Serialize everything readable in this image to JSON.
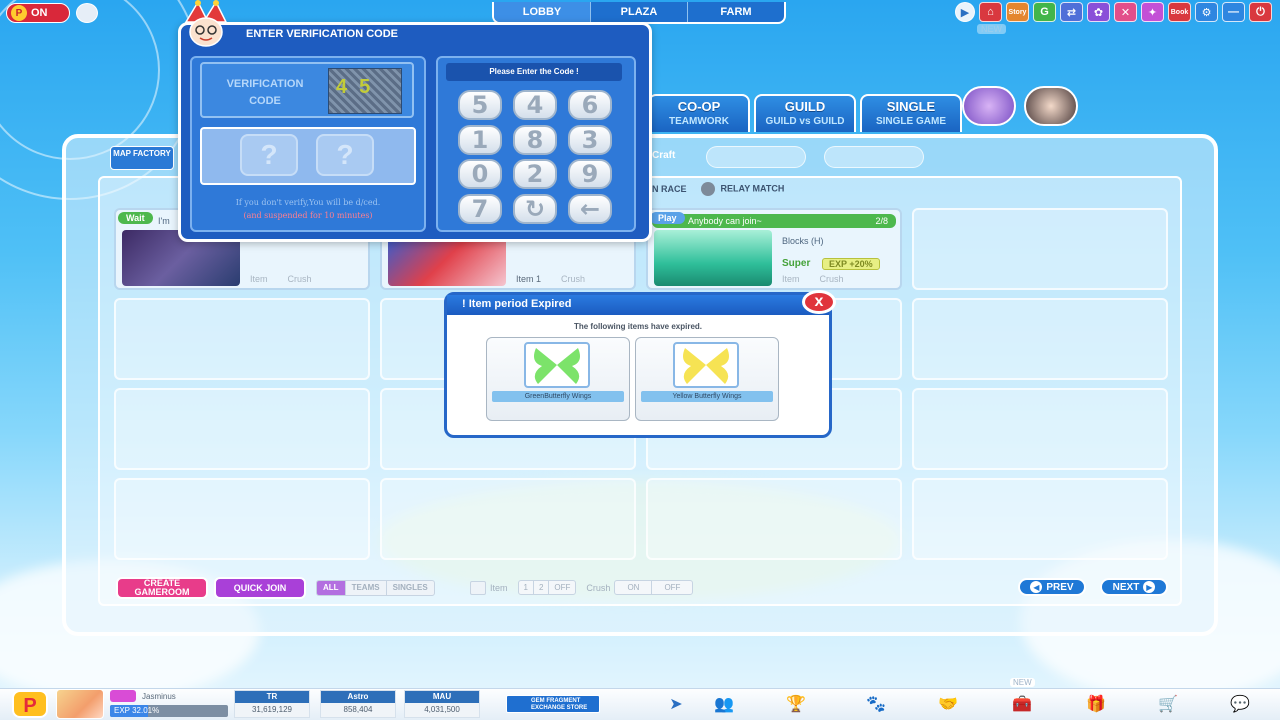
{
  "top_bar": {
    "on_label": "ON",
    "main_tabs": [
      "LOBBY",
      "PLAZA",
      "FARM"
    ],
    "new_tag": "NEW"
  },
  "mode_tabs": [
    {
      "title": "CO-OP",
      "subtitle": "TEAMWORK"
    },
    {
      "title": "GUILD",
      "subtitle": "GUILD vs GUILD"
    },
    {
      "title": "SINGLE",
      "subtitle": "SINGLE GAME"
    }
  ],
  "lobby": {
    "map_factory_label": "MAP FACTORY",
    "craft_label": "Craft",
    "filters": [
      "N RACE",
      "RELAY MATCH"
    ]
  },
  "rooms": [
    {
      "badge": "Wait",
      "title": "I'm",
      "items": [
        "Item",
        "Crush"
      ]
    },
    {
      "badge": "",
      "title": "",
      "items": [
        "Item 1",
        "Crush"
      ]
    },
    {
      "badge": "Play",
      "title": "Anybody can join~",
      "count": "2/8",
      "map": "Blocks (H)",
      "super": "Super",
      "exp": "EXP +20%",
      "items": [
        "Item",
        "Crush"
      ]
    }
  ],
  "bottom_controls": {
    "create_gameroom": "CREATE GAMEROOM",
    "quick_join": "QUICK JOIN",
    "mode_filter": [
      "ALL",
      "TEAMS",
      "SINGLES"
    ],
    "item_label": "Item",
    "item_opts": [
      "1",
      "2",
      "OFF"
    ],
    "crush_label": "Crush",
    "crush_opts": [
      "ON",
      "OFF"
    ],
    "prev": "PREV",
    "next": "NEXT"
  },
  "status_bar": {
    "player_name": "Jasminus",
    "exp_text": "EXP 32.01%",
    "exp_progress": 0.3201,
    "stats": [
      {
        "label": "TR",
        "value": "31,619,129"
      },
      {
        "label": "Astro",
        "value": "858,404"
      },
      {
        "label": "MAU",
        "value": "4,031,500"
      }
    ],
    "gem_store": "GEM FRAGMENT EXCHANGE STORE",
    "new_tag": "NEW"
  },
  "verify_dialog": {
    "title": "ENTER VERIFICATION CODE",
    "code_label": "VERIFICATION CODE",
    "captcha_text": "45",
    "answer_slots": [
      "?",
      "?"
    ],
    "note_line1": "If you don't verify,You will be d/ced.",
    "note_line2": "(and suspended for 10 minutes)",
    "keypad_title": "Please Enter the Code !",
    "keys": [
      "5",
      "4",
      "6",
      "1",
      "8",
      "3",
      "0",
      "2",
      "9",
      "7",
      "↻",
      "←"
    ]
  },
  "expired_dialog": {
    "title": "! Item period Expired",
    "message": "The following items have expired.",
    "items": [
      {
        "name": "GreenButterfly Wings",
        "color": "#6ee05a"
      },
      {
        "name": "Yellow Butterfly Wings",
        "color": "#f5e24a"
      }
    ],
    "close": "x"
  },
  "colors": {
    "accent": "#1e5cc0",
    "create": "#e83c8a",
    "quick_join": "#a940d8",
    "close_red": "#e0343c"
  }
}
